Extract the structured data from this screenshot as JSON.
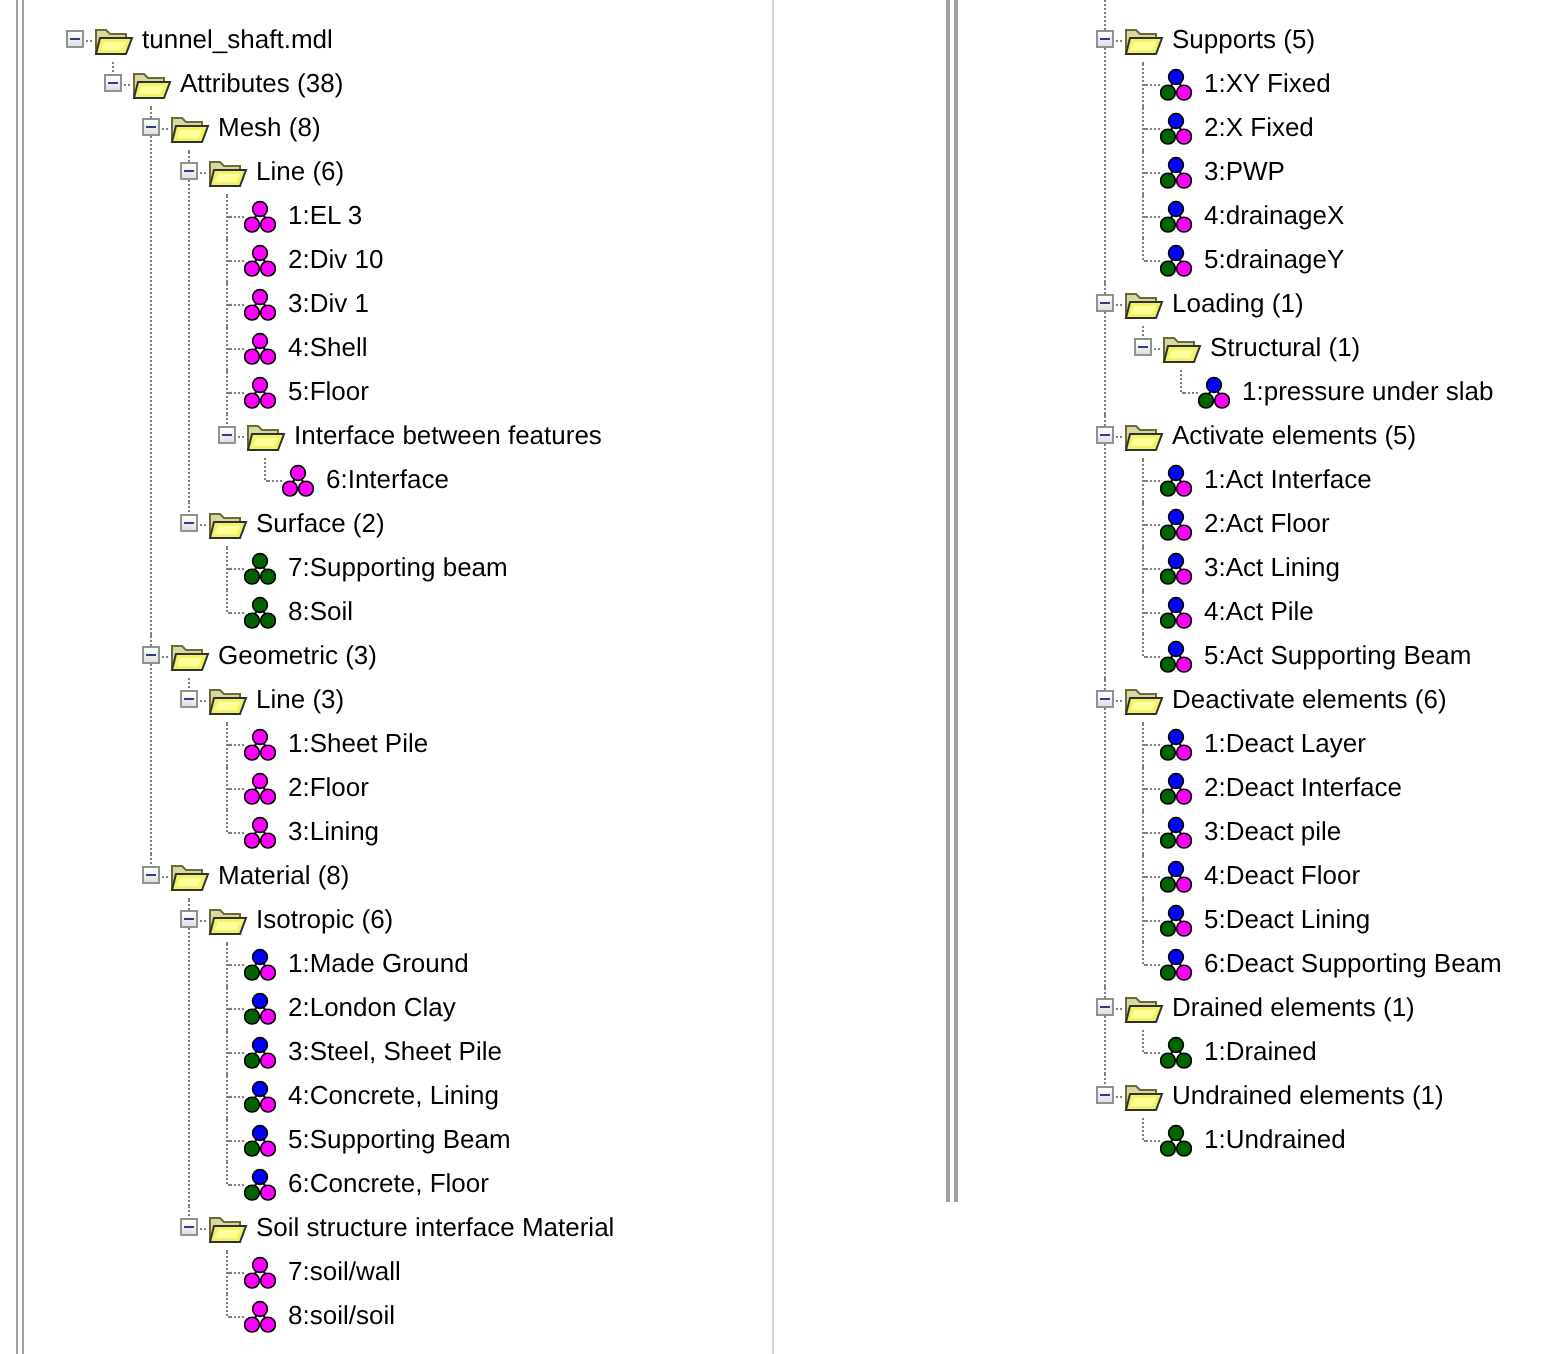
{
  "left_tree": [
    {
      "label": "tunnel_shaft.mdl",
      "expanded": true,
      "children": [
        {
          "label": "Attributes (38)",
          "expanded": true,
          "children": [
            {
              "label": "Mesh (8)",
              "expanded": true,
              "children": [
                {
                  "label": "Line (6)",
                  "expanded": true,
                  "children": [
                    {
                      "label": "1:EL 3",
                      "kind": "pink"
                    },
                    {
                      "label": "2:Div 10",
                      "kind": "pink"
                    },
                    {
                      "label": "3:Div 1",
                      "kind": "pink"
                    },
                    {
                      "label": "4:Shell",
                      "kind": "pink"
                    },
                    {
                      "label": "5:Floor",
                      "kind": "pink"
                    },
                    {
                      "label": "Interface between features",
                      "expanded": true,
                      "children": [
                        {
                          "label": "6:Interface",
                          "kind": "pink"
                        }
                      ]
                    }
                  ]
                },
                {
                  "label": "Surface (2)",
                  "expanded": true,
                  "children": [
                    {
                      "label": "7:Supporting beam",
                      "kind": "green"
                    },
                    {
                      "label": "8:Soil",
                      "kind": "green"
                    }
                  ]
                }
              ]
            },
            {
              "label": "Geometric (3)",
              "expanded": true,
              "children": [
                {
                  "label": "Line (3)",
                  "expanded": true,
                  "children": [
                    {
                      "label": "1:Sheet Pile",
                      "kind": "pink"
                    },
                    {
                      "label": "2:Floor",
                      "kind": "pink"
                    },
                    {
                      "label": "3:Lining",
                      "kind": "pink"
                    }
                  ]
                }
              ]
            },
            {
              "label": "Material (8)",
              "expanded": true,
              "children": [
                {
                  "label": "Isotropic (6)",
                  "expanded": true,
                  "children": [
                    {
                      "label": "1:Made Ground",
                      "kind": "mixed"
                    },
                    {
                      "label": "2:London Clay",
                      "kind": "mixed"
                    },
                    {
                      "label": "3:Steel, Sheet Pile",
                      "kind": "mixed"
                    },
                    {
                      "label": "4:Concrete, Lining",
                      "kind": "mixed"
                    },
                    {
                      "label": "5:Supporting Beam",
                      "kind": "mixed"
                    },
                    {
                      "label": "6:Concrete, Floor",
                      "kind": "mixed"
                    }
                  ]
                },
                {
                  "label": "Soil structure interface Material",
                  "expanded": true,
                  "children": [
                    {
                      "label": "7:soil/wall",
                      "kind": "pink"
                    },
                    {
                      "label": "8:soil/soil",
                      "kind": "pink"
                    }
                  ]
                }
              ]
            }
          ]
        }
      ]
    }
  ],
  "right_tree": [
    {
      "label": "Supports (5)",
      "expanded": true,
      "children": [
        {
          "label": "1:XY Fixed",
          "kind": "mixed"
        },
        {
          "label": "2:X Fixed",
          "kind": "mixed"
        },
        {
          "label": "3:PWP",
          "kind": "mixed"
        },
        {
          "label": "4:drainageX",
          "kind": "mixed"
        },
        {
          "label": "5:drainageY",
          "kind": "mixed"
        }
      ]
    },
    {
      "label": "Loading (1)",
      "expanded": true,
      "children": [
        {
          "label": "Structural (1)",
          "expanded": true,
          "children": [
            {
              "label": "1:pressure under slab",
              "kind": "mixed"
            }
          ]
        }
      ]
    },
    {
      "label": "Activate elements (5)",
      "expanded": true,
      "children": [
        {
          "label": "1:Act Interface",
          "kind": "mixed"
        },
        {
          "label": "2:Act Floor",
          "kind": "mixed"
        },
        {
          "label": "3:Act Lining",
          "kind": "mixed"
        },
        {
          "label": "4:Act Pile",
          "kind": "mixed"
        },
        {
          "label": "5:Act Supporting Beam",
          "kind": "mixed"
        }
      ]
    },
    {
      "label": "Deactivate elements (6)",
      "expanded": true,
      "children": [
        {
          "label": "1:Deact Layer",
          "kind": "mixed"
        },
        {
          "label": "2:Deact Interface",
          "kind": "mixed"
        },
        {
          "label": "3:Deact pile",
          "kind": "mixed"
        },
        {
          "label": "4:Deact Floor",
          "kind": "mixed"
        },
        {
          "label": "5:Deact Lining",
          "kind": "mixed"
        },
        {
          "label": "6:Deact Supporting Beam",
          "kind": "mixed"
        }
      ]
    },
    {
      "label": "Drained elements (1)",
      "expanded": true,
      "children": [
        {
          "label": "1:Drained",
          "kind": "green"
        }
      ]
    },
    {
      "label": "Undrained elements (1)",
      "expanded": true,
      "children": [
        {
          "label": "1:Undrained",
          "kind": "green"
        }
      ]
    }
  ]
}
